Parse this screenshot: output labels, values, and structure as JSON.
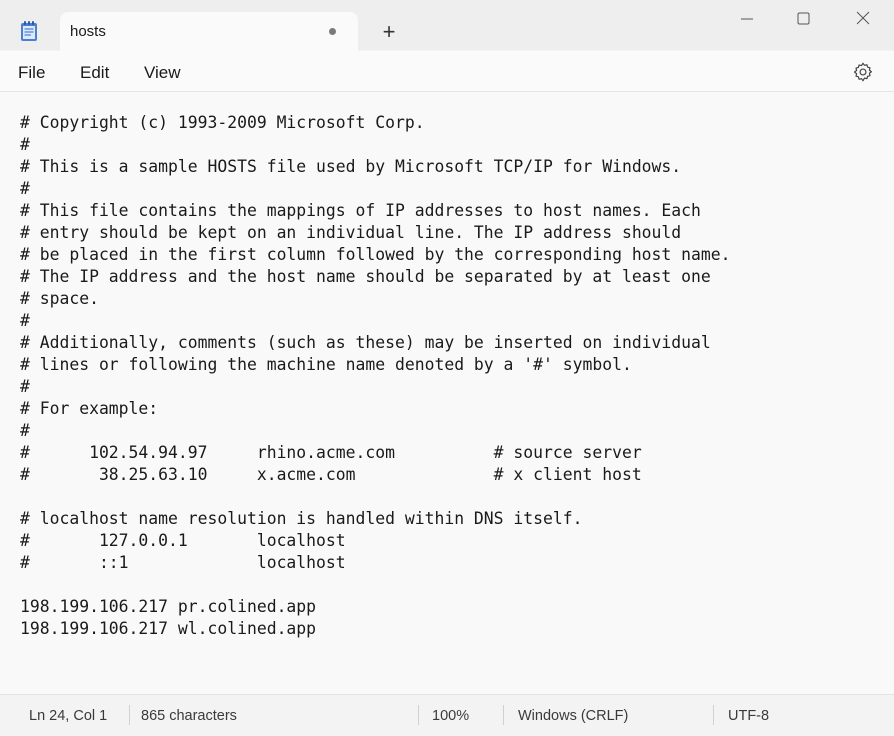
{
  "tab": {
    "title": "hosts",
    "unsaved": true,
    "new_tab": "+"
  },
  "window_controls": [
    "minimize",
    "maximize",
    "close"
  ],
  "menu": {
    "file": "File",
    "edit": "Edit",
    "view": "View"
  },
  "icons": {
    "app": "notepad-icon",
    "settings": "gear-icon"
  },
  "editor": {
    "lines": [
      "# Copyright (c) 1993-2009 Microsoft Corp.",
      "#",
      "# This is a sample HOSTS file used by Microsoft TCP/IP for Windows.",
      "#",
      "# This file contains the mappings of IP addresses to host names. Each",
      "# entry should be kept on an individual line. The IP address should",
      "# be placed in the first column followed by the corresponding host name.",
      "# The IP address and the host name should be separated by at least one",
      "# space.",
      "#",
      "# Additionally, comments (such as these) may be inserted on individual",
      "# lines or following the machine name denoted by a '#' symbol.",
      "#",
      "# For example:",
      "#",
      "#      102.54.94.97     rhino.acme.com          # source server",
      "#       38.25.63.10     x.acme.com              # x client host",
      "",
      "# localhost name resolution is handled within DNS itself.",
      "#       127.0.0.1       localhost",
      "#       ::1             localhost",
      "",
      "198.199.106.217 pr.colined.app",
      "198.199.106.217 wl.colined.app"
    ]
  },
  "status": {
    "position": "Ln 24, Col 1",
    "characters": "865 characters",
    "zoom": "100%",
    "line_ending": "Windows (CRLF)",
    "encoding": "UTF-8"
  },
  "colors": {
    "accent": "#3b6fd6",
    "titlebar": "#eeeeee",
    "editor_bg": "#f9f9f9"
  }
}
